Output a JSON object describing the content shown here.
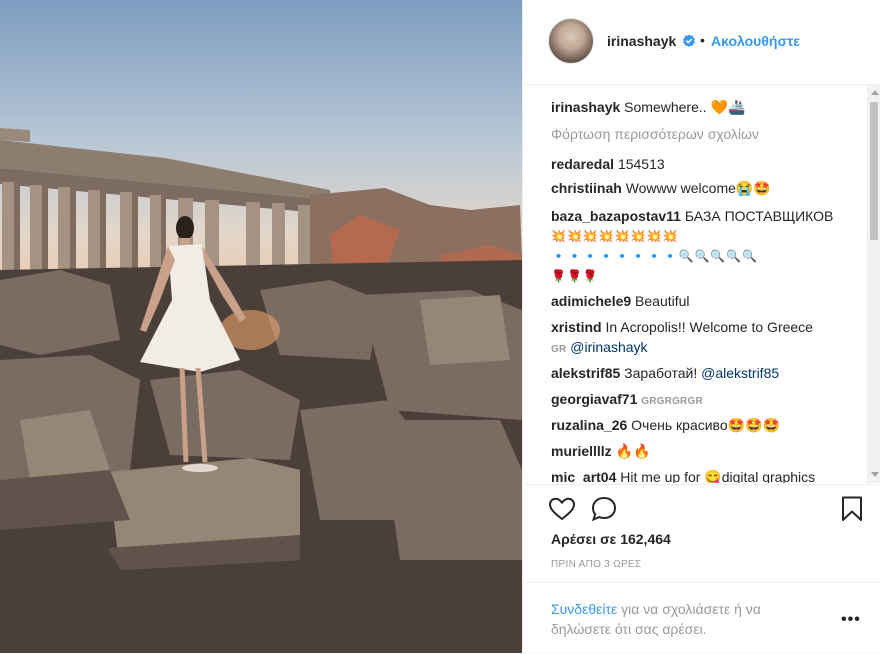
{
  "header": {
    "username": "irinashayk",
    "separator": "•",
    "follow_label": "Ακολουθήστε"
  },
  "caption": {
    "username": "irinashayk",
    "text": "Somewhere.. 🧡🚢"
  },
  "load_more": "Φόρτωση περισσότερων σχολίων",
  "comments": [
    {
      "username": "redaredal",
      "text": "154513"
    },
    {
      "username": "christiinah",
      "text": "Wowww welcome😭🤩"
    },
    {
      "username": "baza_bazapostav11",
      "text": "БАЗА ПОСТАВЩИКОВ"
    },
    {
      "username": "adimichele9",
      "text": "Beautiful"
    },
    {
      "username": "xristind",
      "text": "In Acropolis!! Welcome to Greece"
    },
    {
      "username": "alekstrif85",
      "text": "Заработай!"
    },
    {
      "username": "georgiavaf71",
      "text": "GRGRGRGR"
    },
    {
      "username": "ruzalina_26",
      "text": "Очень красиво🤩🤩🤩"
    },
    {
      "username": "muriellllz",
      "text": "🔥🔥"
    },
    {
      "username": "mic_art04",
      "text": "Hit me up for 😋digital graphics"
    }
  ],
  "baza_emoji_line1": "💥💥💥💥💥💥💥💥",
  "baza_emoji_line2": "🔹🔹🔹🔹🔹🔹🔹🔹🔍🔍🔍🔍🔍",
  "baza_emoji_line3": "🌹🌹🌹",
  "xristind_sub": "GR",
  "xristind_mention": "@irinashayk",
  "alekstrif_mention": "@alekstrif85",
  "likes": "Αρέσει σε 162,464",
  "time": "ΠΡΙΝ ΑΠΟ 3 ΩΡΕΣ",
  "login": {
    "link": "Συνδεθείτε",
    "rest": " για να σχολιάσετε ή να δηλώσετε ότι σας αρέσει."
  },
  "more_label": "•••",
  "icons": {
    "like": "heart-icon",
    "comment": "comment-bubble-icon",
    "save": "bookmark-icon",
    "verified": "verified-badge-icon"
  },
  "colors": {
    "link_blue": "#3897f0",
    "text": "#262626",
    "muted": "#999999",
    "mention": "#003569"
  }
}
